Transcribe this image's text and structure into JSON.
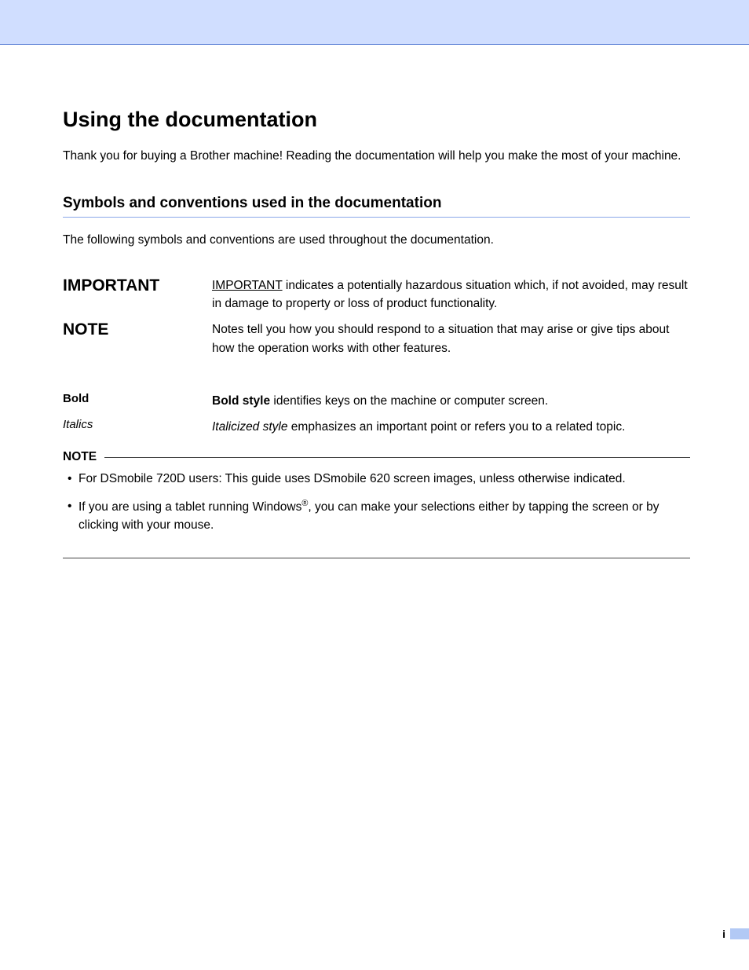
{
  "heading": "Using the documentation",
  "intro": "Thank you for buying a Brother machine! Reading the documentation will help you make the most of your machine.",
  "subheading": "Symbols and conventions used in the documentation",
  "conventions_intro": "The following symbols and conventions are used throughout the documentation.",
  "rows": {
    "important": {
      "label": "IMPORTANT",
      "lead_ul": "IMPORTANT",
      "rest": " indicates a potentially hazardous situation which, if not avoided, may result in damage to property or loss of product functionality."
    },
    "note": {
      "label": "NOTE",
      "text": "Notes tell you how you should respond to a situation that may arise or give tips about how the operation works with other features."
    },
    "bold": {
      "label": "Bold",
      "lead_b": "Bold style",
      "rest": " identifies keys on the machine or computer screen."
    },
    "italics": {
      "label": "Italics",
      "lead_i": "Italicized style",
      "rest": " emphasizes an important point or refers you to a related topic."
    }
  },
  "notebox": {
    "title": "NOTE",
    "item1": "For DSmobile 720D users: This guide uses DSmobile 620 screen images, unless otherwise indicated.",
    "item2_a": "If you are using a tablet running Windows",
    "item2_sup": "®",
    "item2_b": ", you can make your selections either by tapping the screen or by clicking with your mouse."
  },
  "page_number": "i"
}
